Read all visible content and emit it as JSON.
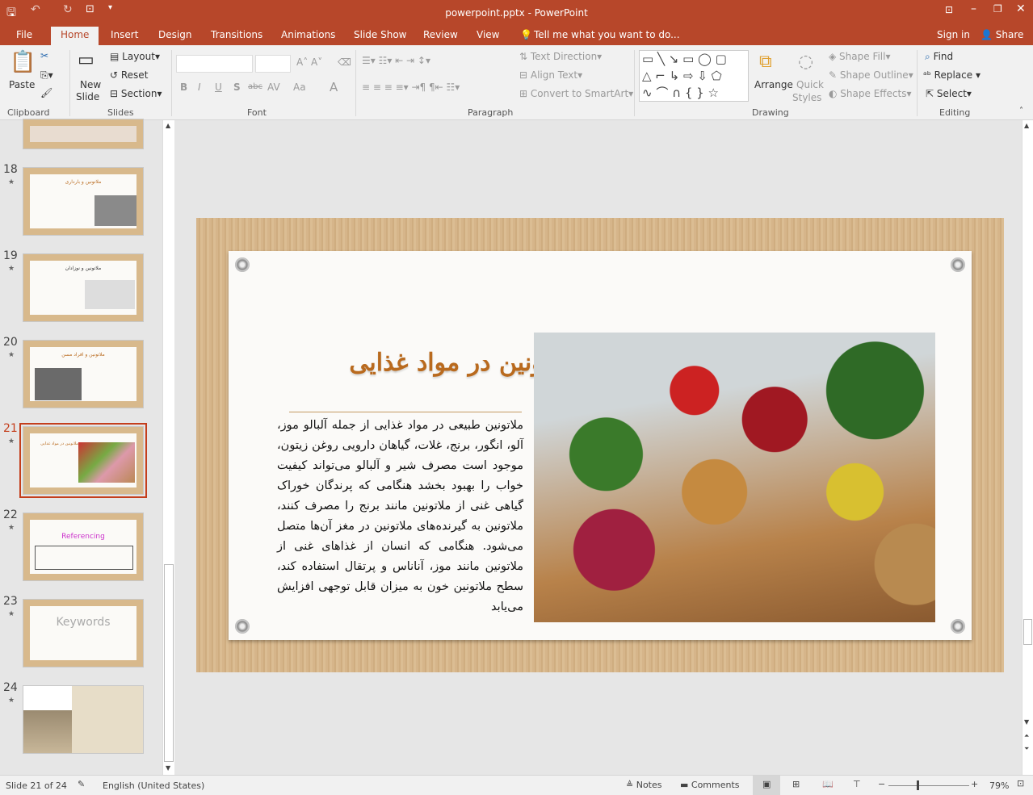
{
  "window": {
    "title": "powerpoint.pptx - PowerPoint"
  },
  "tabs": [
    "File",
    "Home",
    "Insert",
    "Design",
    "Transitions",
    "Animations",
    "Slide Show",
    "Review",
    "View"
  ],
  "tell_me": "Tell me what you want to do...",
  "sign_in": "Sign in",
  "share": "Share",
  "ribbon": {
    "clipboard": {
      "paste": "Paste",
      "label": "Clipboard"
    },
    "slides": {
      "new_slide": "New",
      "new_slide2": "Slide",
      "layout": "Layout",
      "reset": "Reset",
      "section": "Section",
      "label": "Slides"
    },
    "font": {
      "label": "Font",
      "bold": "B",
      "italic": "I",
      "underline": "U",
      "shadow": "S",
      "strike": "abc",
      "spacing": "AV",
      "case": "Aa",
      "color": "A"
    },
    "paragraph": {
      "label": "Paragraph",
      "text_direction": "Text Direction",
      "align_text": "Align Text",
      "smartart": "Convert to SmartArt"
    },
    "drawing": {
      "label": "Drawing",
      "arrange": "Arrange",
      "quick_styles": "Quick",
      "quick_styles2": "Styles",
      "shape_fill": "Shape Fill",
      "shape_outline": "Shape Outline",
      "shape_effects": "Shape Effects"
    },
    "editing": {
      "label": "Editing",
      "find": "Find",
      "replace": "Replace",
      "select": "Select"
    }
  },
  "thumbnails": [
    {
      "num": "18",
      "title": "ملاتونین و بارداری"
    },
    {
      "num": "19",
      "title": "ملاتونین و نوزادان"
    },
    {
      "num": "20",
      "title": "ملاتونین و افراد مسن"
    },
    {
      "num": "21",
      "title": "ملاتونین در مواد غذایی"
    },
    {
      "num": "22",
      "title": "Referencing"
    },
    {
      "num": "23",
      "title": "Keywords"
    },
    {
      "num": "24",
      "title": ""
    }
  ],
  "slide": {
    "title": "ملاتونین در مواد غذایی",
    "body": "ملاتونین طبیعی در مواد غذایی از جمله آلبالو موز، آلو، انگور، برنج، غلات، گیاهان دارویی روغن زیتون، موجود است مصرف شیر و آلبالو می‌تواند کیفیت خواب را بهبود بخشد هنگامی که پرندگان خوراک گیاهی غنی از ملاتونین مانند برنج را مصرف کنند، ملاتونین به گیرنده‌های ملاتونین در مغز آن‌ها متصل می‌شود. هنگامی که انسان از غذاهای غنی از ملاتونین مانند موز، آناناس و پرتقال استفاده کند، سطح ملاتونین خون به میزان قابل توجهی افزایش می‌یابد"
  },
  "status": {
    "slide": "Slide 21 of 24",
    "language": "English (United States)",
    "notes": "Notes",
    "comments": "Comments",
    "zoom": "79%"
  },
  "colors": {
    "accent": "#b7472a",
    "title": "#b96a1e"
  }
}
